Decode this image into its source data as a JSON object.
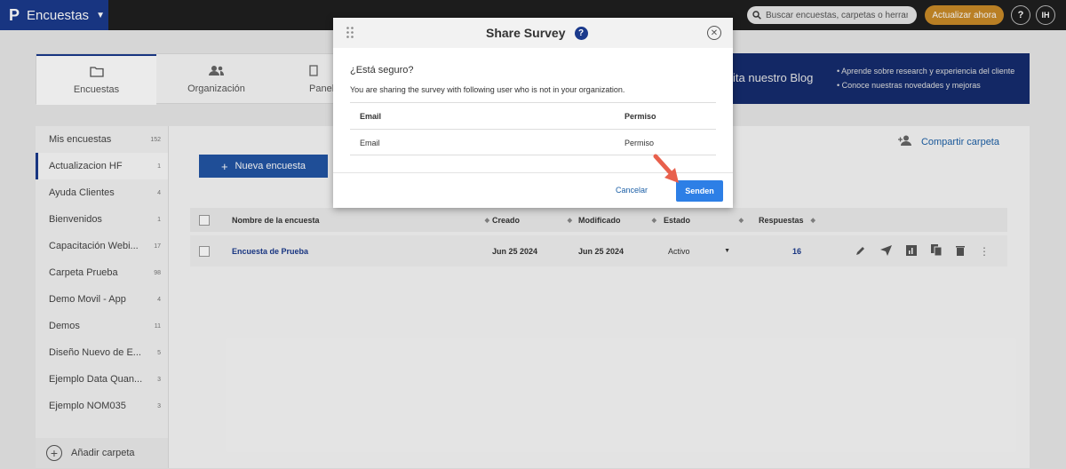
{
  "topbar": {
    "brand_logo": "P",
    "brand_name": "Encuestas",
    "search_placeholder": "Buscar encuestas, carpetas o herrami",
    "upgrade_label": "Actualizar ahora",
    "help_label": "?",
    "avatar_initials": "IH"
  },
  "tabs": [
    {
      "label": "Encuestas",
      "icon": "folder-icon",
      "active": true
    },
    {
      "label": "Organización",
      "icon": "users-icon",
      "active": false
    },
    {
      "label": "Panel",
      "icon": "panel-icon",
      "active": false
    }
  ],
  "blog": {
    "title": "ita nuestro Blog",
    "bullets": [
      "Aprende sobre research y experiencia del cliente",
      "Conoce nuestras novedades y mejoras"
    ]
  },
  "sidebar": {
    "folders": [
      {
        "name": "Mis encuestas",
        "count": "152"
      },
      {
        "name": "Actualizacion HF",
        "count": "1"
      },
      {
        "name": "Ayuda Clientes",
        "count": "4"
      },
      {
        "name": "Bienvenidos",
        "count": "1"
      },
      {
        "name": "Capacitación Webi...",
        "count": "17"
      },
      {
        "name": "Carpeta Prueba",
        "count": "98"
      },
      {
        "name": "Demo Movil - App",
        "count": "4"
      },
      {
        "name": "Demos",
        "count": "11"
      },
      {
        "name": "Diseño Nuevo de E...",
        "count": "5"
      },
      {
        "name": "Ejemplo Data Quan...",
        "count": "3"
      },
      {
        "name": "Ejemplo NOM035",
        "count": "3"
      }
    ],
    "add_folder_label": "Añadir carpeta"
  },
  "main": {
    "share_folder_label": "Compartir carpeta",
    "new_survey_label": "Nueva encuesta",
    "columns": [
      "Nombre de la encuesta",
      "Creado",
      "Modificado",
      "Estado",
      "Respuestas"
    ],
    "rows": [
      {
        "name": "Encuesta de Prueba",
        "created": "Jun 25 2024",
        "modified": "Jun 25 2024",
        "status": "Activo",
        "responses": "16"
      }
    ]
  },
  "modal": {
    "title": "Share Survey",
    "question": "¿Está seguro?",
    "description": "You are sharing the survey with following user who is not in your organization.",
    "table_headers": [
      "Email",
      "Permiso"
    ],
    "table_rows": [
      [
        "Email",
        "Permiso"
      ]
    ],
    "cancel_label": "Cancelar",
    "send_label": "Senden"
  },
  "colors": {
    "brand": "#1b3a8c",
    "send_button": "#2d7fe6",
    "upgrade_button": "#c98a28",
    "pointer_arrow": "#e8604c"
  }
}
